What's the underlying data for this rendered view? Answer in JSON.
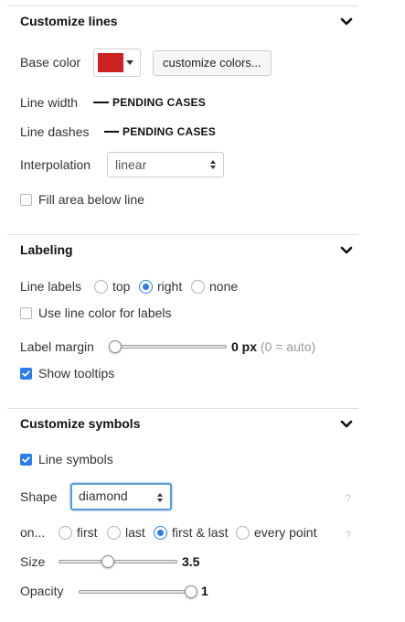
{
  "customize_lines": {
    "title": "Customize lines",
    "base_color_label": "Base color",
    "base_color": "#cc2222",
    "customize_colors_button": "customize colors...",
    "line_width_label": "Line width",
    "line_width_sample": "PENDING CASES",
    "line_dashes_label": "Line dashes",
    "line_dashes_sample": "PENDING CASES",
    "interpolation_label": "Interpolation",
    "interpolation_value": "linear",
    "fill_area_label": "Fill area below line",
    "fill_area_checked": false
  },
  "labeling": {
    "title": "Labeling",
    "line_labels_label": "Line labels",
    "options": [
      "top",
      "right",
      "none"
    ],
    "selected": "right",
    "use_line_color_label": "Use line color for labels",
    "use_line_color_checked": false,
    "label_margin_label": "Label margin",
    "label_margin_value": "0 px",
    "label_margin_hint": "(0 = auto)",
    "label_margin_level": 0,
    "show_tooltips_label": "Show tooltips",
    "show_tooltips_checked": true
  },
  "customize_symbols": {
    "title": "Customize symbols",
    "line_symbols_label": "Line symbols",
    "line_symbols_checked": true,
    "shape_label": "Shape",
    "shape_value": "diamond",
    "on_label": "on...",
    "on_options": [
      "first",
      "last",
      "first & last",
      "every point"
    ],
    "on_selected": "first & last",
    "size_label": "Size",
    "size_value": "3.5",
    "size_level": 0.42,
    "opacity_label": "Opacity",
    "opacity_value": "1",
    "opacity_level": 1.0,
    "help_glyph": "?"
  },
  "colors": {
    "accent": "#2b7de9",
    "swatch": "#cc2222"
  }
}
